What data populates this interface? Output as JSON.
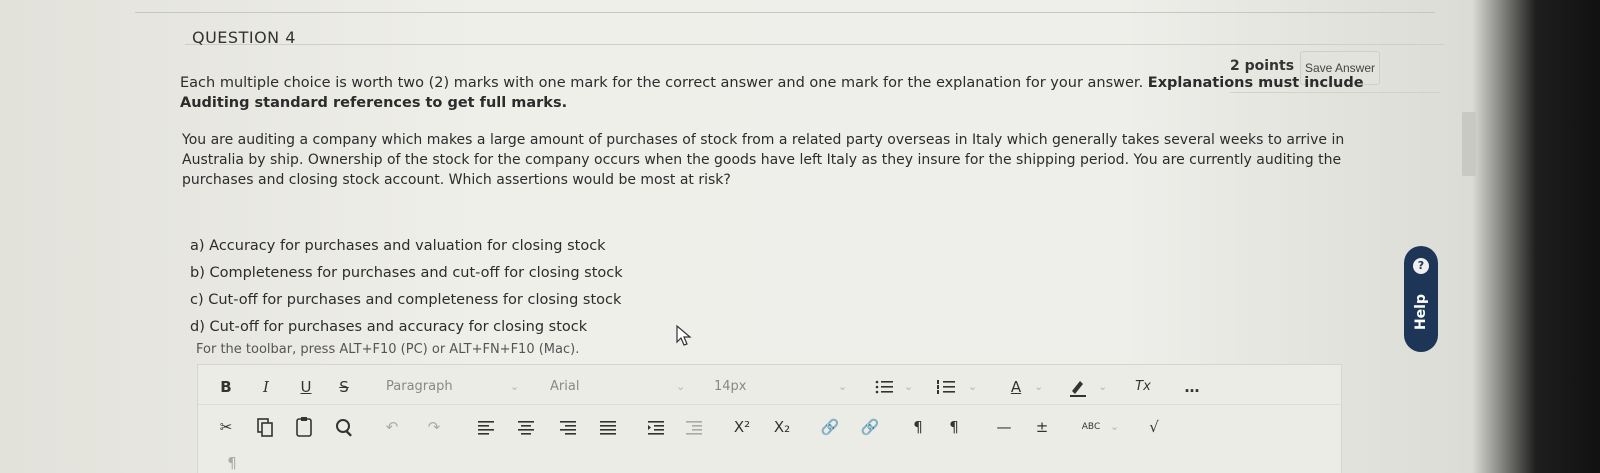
{
  "question": {
    "title": "QUESTION 4",
    "points": "2 points",
    "save_label": "Save Answer",
    "instructions_plain": "Each multiple choice is worth two (2) marks with one mark for the correct answer and one mark for the explanation for your answer. ",
    "instructions_bold": "Explanations must include Auditing standard references to get full marks.",
    "scenario": "You are auditing a company which makes a large amount of purchases of stock from a related party overseas in Italy which generally takes several weeks to arrive in Australia by ship. Ownership of the stock for the company occurs when the goods have left Italy as they insure for the shipping period. You are currently auditing the purchases and closing stock account.  Which assertions would be most at risk?",
    "options": [
      "a) Accuracy for purchases and valuation for closing stock",
      "b) Completeness for purchases and cut-off for closing stock",
      "c) Cut-off for purchases and completeness for closing stock",
      "d) Cut-off for purchases and accuracy for closing stock"
    ]
  },
  "editor": {
    "hint": "For the toolbar, press ALT+F10 (PC) or ALT+FN+F10 (Mac).",
    "bold": "B",
    "italic": "I",
    "underline": "U",
    "strikethrough": "S",
    "paragraph": "Paragraph",
    "font": "Arial",
    "size": "14px",
    "text_color": "A",
    "clear_format": "Tx",
    "more": "…",
    "superscript": "X²",
    "subscript": "X₂",
    "ltr": "¶",
    "rtl": "¶",
    "hr": "—",
    "spell": "ABC"
  },
  "help": {
    "label": "Help",
    "icon": "?"
  },
  "colors": {
    "help_tab": "#1d3557",
    "page_bg": "#ecece7"
  }
}
